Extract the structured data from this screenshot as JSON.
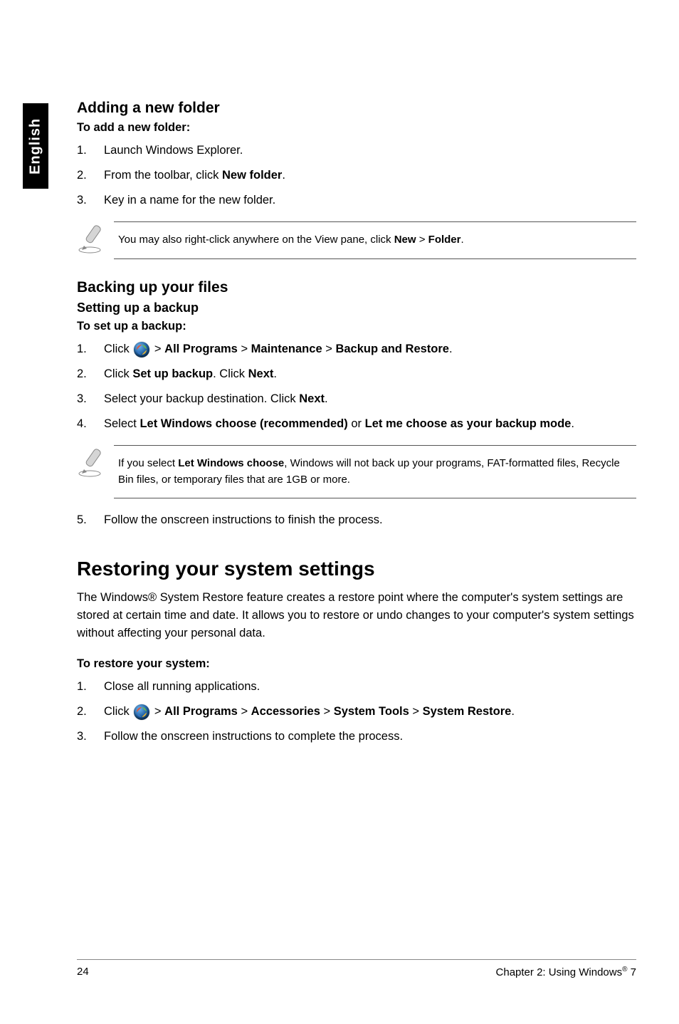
{
  "sidebar": {
    "language": "English"
  },
  "s1": {
    "title": "Adding a new folder",
    "sub": "To add a new folder:",
    "steps": [
      "Launch Windows Explorer.",
      {
        "pre": "From the toolbar, click ",
        "b1": "New folder",
        "post": "."
      },
      "Key in a name for the new folder."
    ],
    "note": {
      "pre": "You may also right-click anywhere on the View pane, click ",
      "b1": "New",
      "gt": " > ",
      "b2": "Folder",
      "post": "."
    }
  },
  "s2": {
    "title": "Backing up your files",
    "sub_heading": "Setting up a backup",
    "sub": "To set up a backup:",
    "step1": {
      "pre": "Click ",
      "gt1": " > ",
      "b1": "All Programs",
      "gt2": " > ",
      "b2": "Maintenance",
      "gt3": " > ",
      "b3": "Backup and Restore",
      "post": "."
    },
    "step2": {
      "pre": "Click ",
      "b1": "Set up backup",
      "mid": ". Click ",
      "b2": "Next",
      "post": "."
    },
    "step3": {
      "pre": "Select your backup destination. Click ",
      "b1": "Next",
      "post": "."
    },
    "step4": {
      "pre": "Select ",
      "b1": "Let Windows choose (recommended)",
      "mid": " or ",
      "b2": "Let me choose as your backup mode",
      "post": "."
    },
    "note": {
      "pre": "If you select ",
      "b1": "Let Windows choose",
      "post": ", Windows will not back up your programs, FAT-formatted files, Recycle Bin files, or temporary files that are 1GB or more."
    },
    "step5": "Follow the onscreen instructions to finish the process."
  },
  "s3": {
    "title": "Restoring your system settings",
    "para": "The Windows® System Restore feature creates a restore point where the computer's system settings are stored at certain time and date. It allows you to restore or undo changes to your computer's system settings without affecting your personal data.",
    "sub": "To restore your system:",
    "step1": "Close all running applications.",
    "step2": {
      "pre": "Click ",
      "gt1": " > ",
      "b1": "All Programs",
      "gt2": " > ",
      "b2": "Accessories",
      "gt3": " > ",
      "b3": "System Tools",
      "gt4": " > ",
      "b4": "System Restore",
      "post": "."
    },
    "step3": "Follow the onscreen instructions to complete the process."
  },
  "footer": {
    "page": "24",
    "chapter_pre": "Chapter 2: Using Windows",
    "chapter_sup": "®",
    "chapter_post": " 7"
  }
}
